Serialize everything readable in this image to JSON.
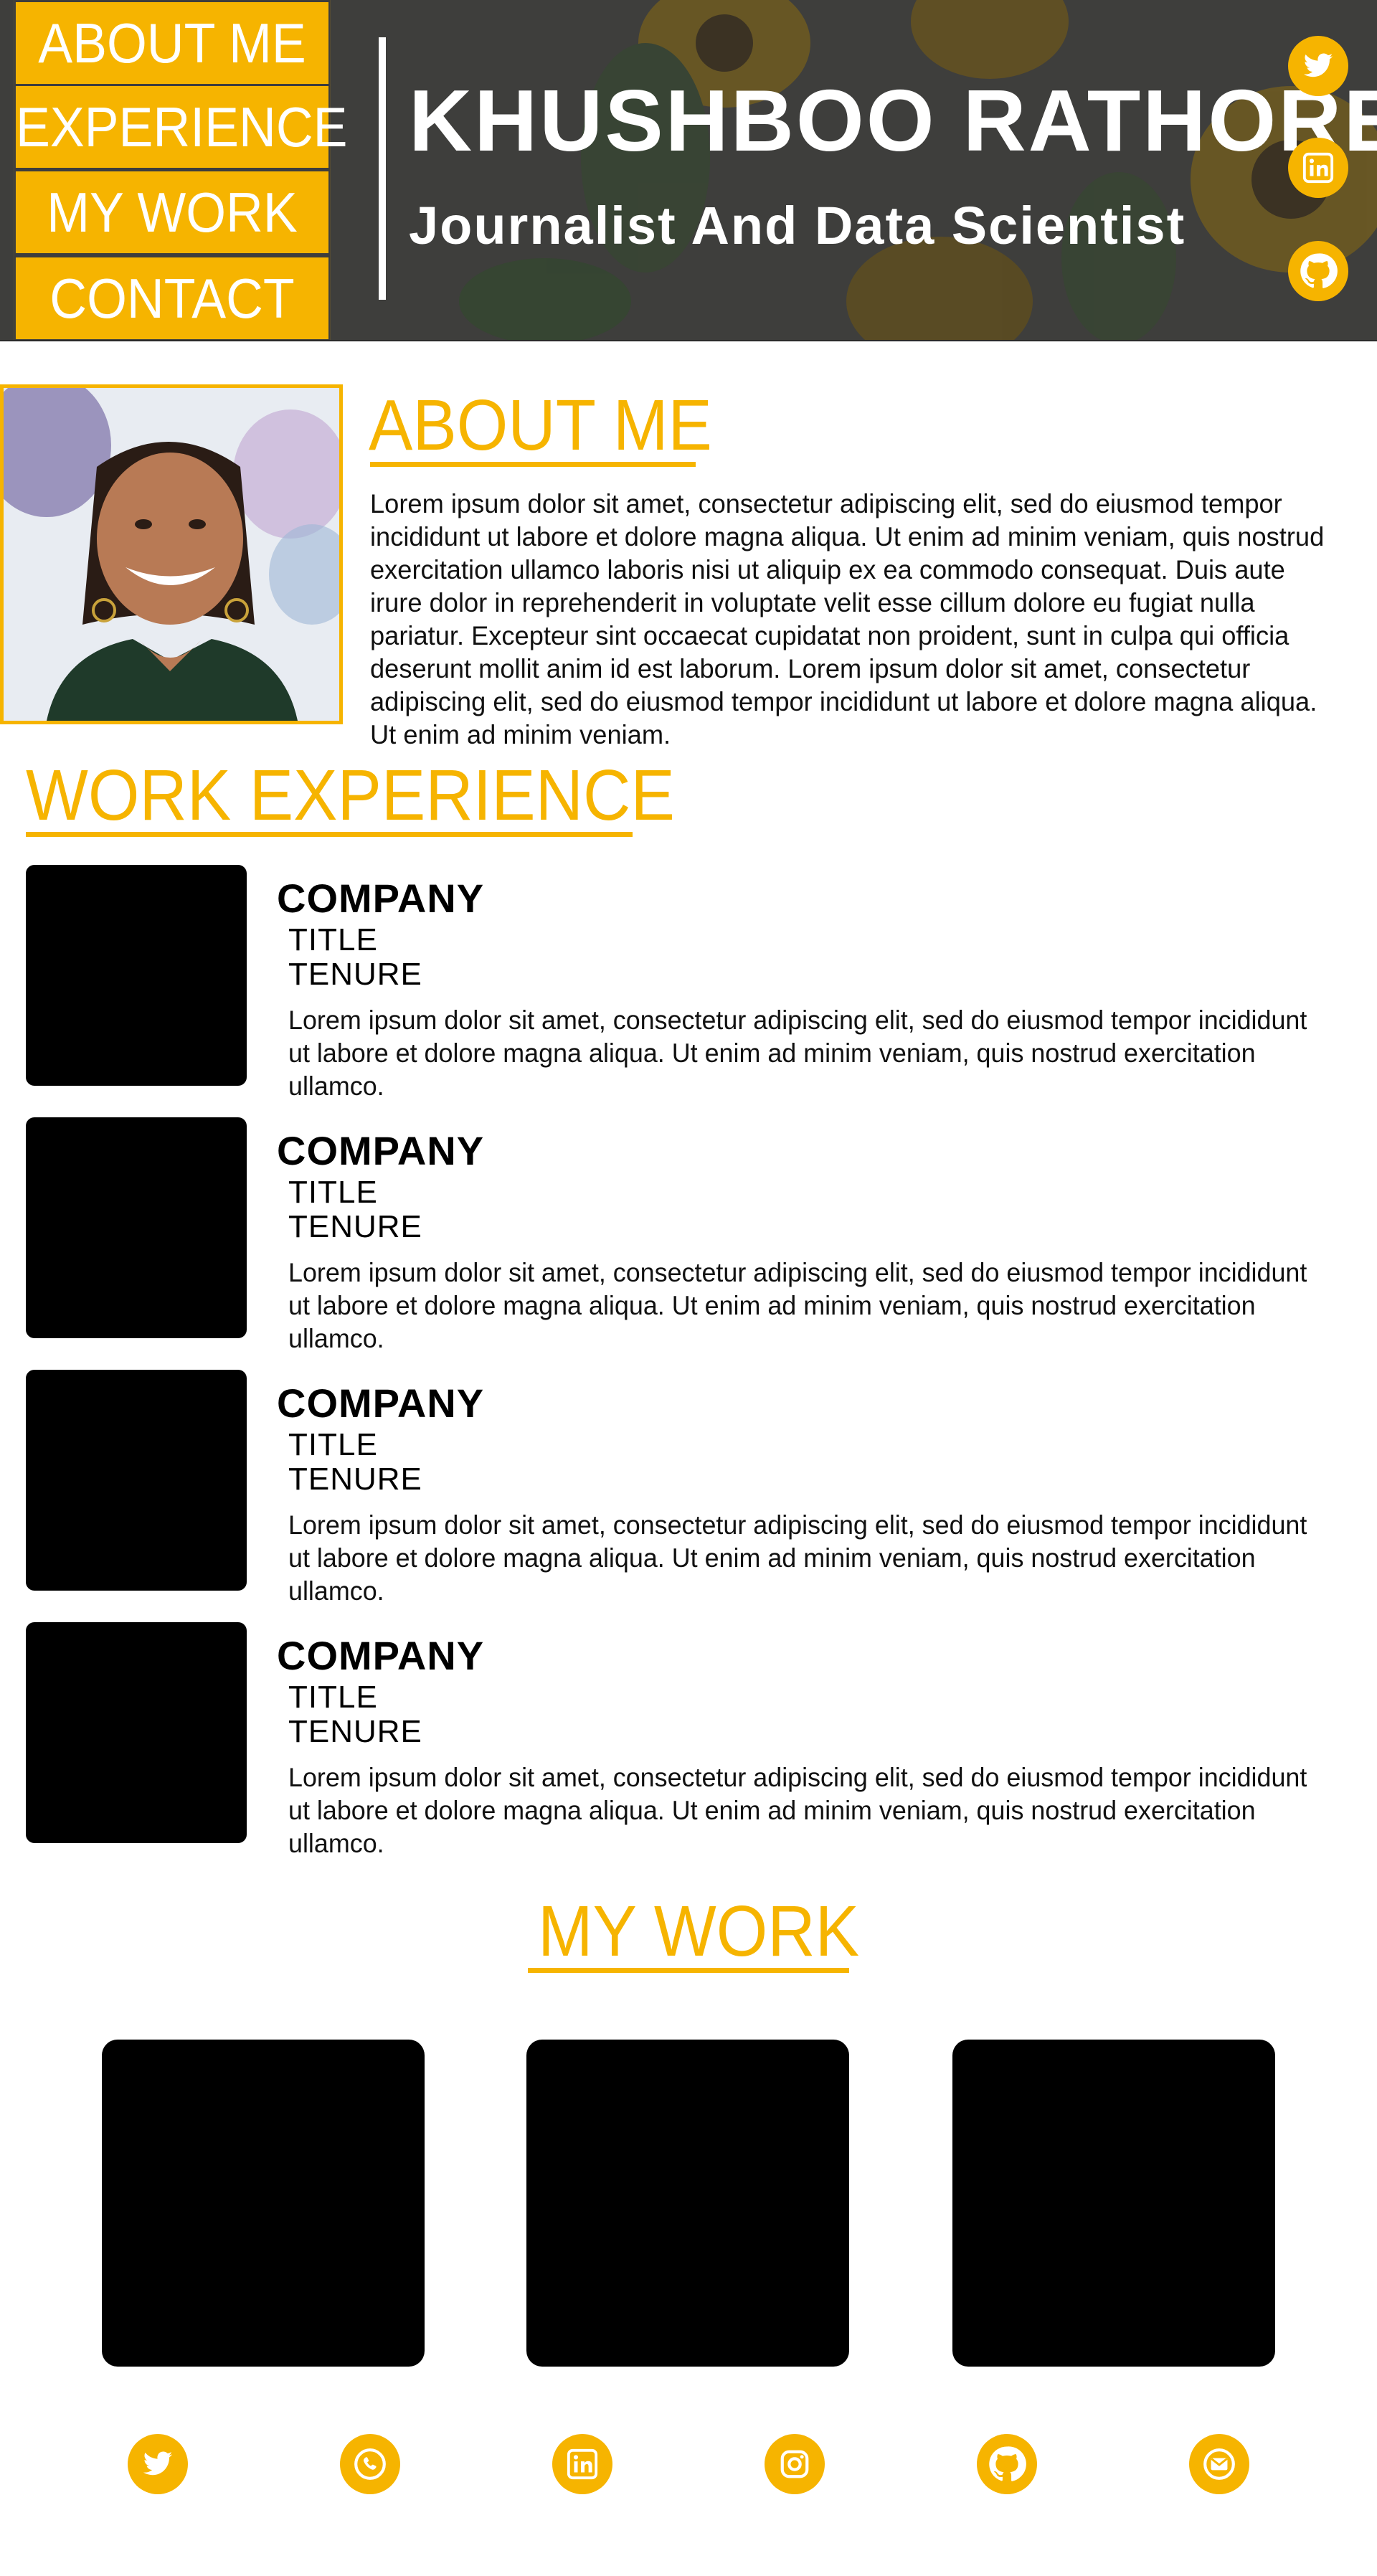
{
  "colors": {
    "accent": "#f6b400",
    "header_bg": "#3b3b3a",
    "text": "#111111",
    "placeholder": "#000000"
  },
  "nav": {
    "items": [
      {
        "label": "ABOUT ME"
      },
      {
        "label": "EXPERIENCE"
      },
      {
        "label": "MY WORK"
      },
      {
        "label": "CONTACT ME"
      }
    ]
  },
  "header": {
    "name": "KHUSHBOO RATHORE",
    "role": "Journalist And Data Scientist",
    "social_icons": [
      "twitter-icon",
      "linkedin-icon",
      "github-icon"
    ]
  },
  "about": {
    "title": "ABOUT ME",
    "text": "Lorem ipsum dolor sit amet, consectetur adipiscing elit, sed do eiusmod tempor incididunt ut labore et dolore magna aliqua. Ut enim ad minim veniam, quis nostrud exercitation ullamco laboris nisi ut aliquip ex ea commodo consequat. Duis aute irure dolor in reprehenderit in voluptate velit esse cillum dolore eu fugiat nulla pariatur. Excepteur sint occaecat cupidatat non proident, sunt in culpa qui officia deserunt mollit anim id est laborum. Lorem ipsum dolor sit amet, consectetur adipiscing elit, sed do eiusmod tempor incididunt ut labore et dolore magna aliqua. Ut enim ad minim veniam."
  },
  "experience": {
    "title": "WORK EXPERIENCE",
    "items": [
      {
        "company": "COMPANY",
        "title": "TITLE",
        "tenure": "TENURE",
        "description": "Lorem ipsum dolor sit amet, consectetur adipiscing elit, sed do eiusmod tempor incididunt ut labore et dolore magna aliqua. Ut enim ad minim veniam, quis nostrud exercitation ullamco."
      },
      {
        "company": "COMPANY",
        "title": "TITLE",
        "tenure": "TENURE",
        "description": "Lorem ipsum dolor sit amet, consectetur adipiscing elit, sed do eiusmod tempor incididunt ut labore et dolore magna aliqua. Ut enim ad minim veniam, quis nostrud exercitation ullamco."
      },
      {
        "company": "COMPANY",
        "title": "TITLE",
        "tenure": "TENURE",
        "description": "Lorem ipsum dolor sit amet, consectetur adipiscing elit, sed do eiusmod tempor incididunt ut labore et dolore magna aliqua. Ut enim ad minim veniam, quis nostrud exercitation ullamco."
      },
      {
        "company": "COMPANY",
        "title": "TITLE",
        "tenure": "TENURE",
        "description": "Lorem ipsum dolor sit amet, consectetur adipiscing elit, sed do eiusmod tempor incididunt ut labore et dolore magna aliqua. Ut enim ad minim veniam, quis nostrud exercitation ullamco."
      }
    ]
  },
  "work": {
    "title": "MY WORK",
    "cards": 3
  },
  "footer": {
    "icons": [
      "twitter-icon",
      "phone-icon",
      "linkedin-icon",
      "instagram-icon",
      "github-icon",
      "email-icon"
    ]
  }
}
